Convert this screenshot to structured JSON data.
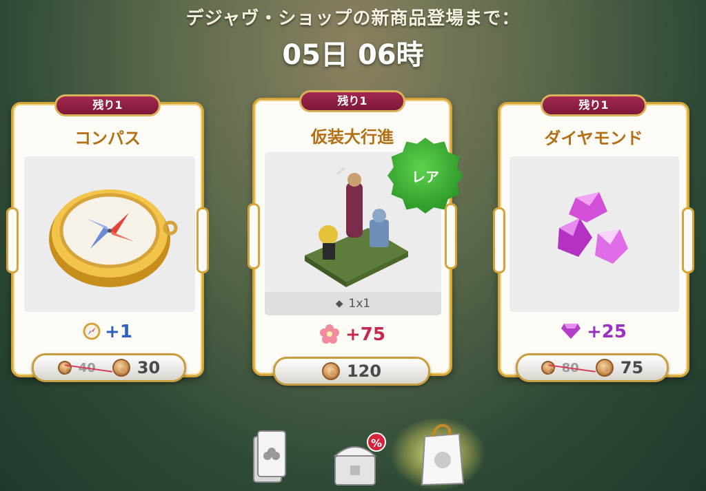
{
  "header": {
    "line1": "デジャヴ・ショップの新商品登場まで：",
    "timer": "05日 06時"
  },
  "cards": [
    {
      "ribbon": "残り1",
      "title": "コンパス",
      "item_icon": "compass-icon",
      "reward_icon": "compass-icon",
      "reward": "+1",
      "reward_color": "#2f5fc0",
      "old_price": "40",
      "price": "30"
    },
    {
      "ribbon": "残り1",
      "title": "仮装大行進",
      "item_icon": "costume-parade-icon",
      "badge": "レア",
      "size": "1x1",
      "reward_icon": "flower-icon",
      "reward": "+75",
      "reward_color": "#c4284f",
      "price": "120"
    },
    {
      "ribbon": "残り1",
      "title": "ダイヤモンド",
      "item_icon": "diamond-icon",
      "reward_icon": "gem-icon",
      "reward": "+25",
      "reward_color": "#9a2fc0",
      "old_price": "80",
      "price": "75"
    }
  ],
  "nav": [
    {
      "icon": "card-pack-icon",
      "active": false
    },
    {
      "icon": "sale-chest-icon",
      "badge": "%",
      "active": false
    },
    {
      "icon": "shopping-bag-icon",
      "active": true
    }
  ]
}
